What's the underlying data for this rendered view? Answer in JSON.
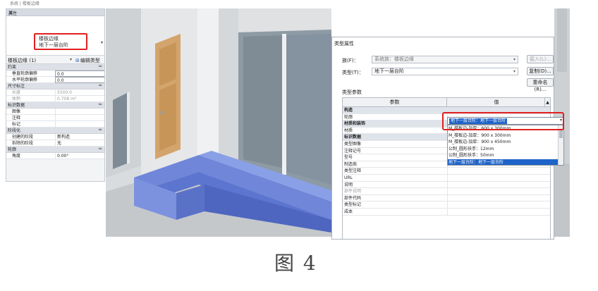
{
  "top_title": "系统 | 楼板边缘",
  "properties_panel": {
    "title": "属性",
    "close_glyph": "×",
    "type_preview": {
      "family": "楼板边缘",
      "type": "地下一层台阶"
    },
    "dropdown_glyph": "▾",
    "selector": {
      "name": "楼板边缘 (1)",
      "edit_type": "编辑类型"
    },
    "rows": [
      {
        "kind": "cat",
        "label": "约束",
        "collapse": "≈"
      },
      {
        "kind": "prop",
        "label": "垂直轮廓偏移",
        "value": "0.0",
        "box": true
      },
      {
        "kind": "prop",
        "label": "水平轮廓偏移",
        "value": "0.0",
        "box": true
      },
      {
        "kind": "cat",
        "label": "尺寸标注",
        "collapse": "≈"
      },
      {
        "kind": "prop",
        "label": "长度",
        "value": "5500.0",
        "gray": true
      },
      {
        "kind": "prop",
        "label": "体积",
        "value": "0.708 m³",
        "gray": true
      },
      {
        "kind": "cat",
        "label": "标识数据",
        "collapse": "≈"
      },
      {
        "kind": "prop",
        "label": "图像",
        "value": ""
      },
      {
        "kind": "prop",
        "label": "注释",
        "value": ""
      },
      {
        "kind": "prop",
        "label": "标记",
        "value": ""
      },
      {
        "kind": "cat",
        "label": "阶段化",
        "collapse": "≈"
      },
      {
        "kind": "prop",
        "label": "创建的阶段",
        "value": "新构造"
      },
      {
        "kind": "prop",
        "label": "拆除的阶段",
        "value": "无"
      },
      {
        "kind": "cat",
        "label": "轮廓",
        "collapse": "≈"
      },
      {
        "kind": "prop",
        "label": "角度",
        "value": "0.00°"
      }
    ]
  },
  "dialog": {
    "title": "类型属性",
    "family_label": "族(F)：",
    "family_value": "系统族：楼板边缘",
    "type_label": "类型(T)：",
    "type_value": "地下一层台阶",
    "buttons": {
      "load": "载入(L)...",
      "duplicate": "复制(D)...",
      "rename": "重命名(R)..."
    },
    "section": "类型参数",
    "columns": {
      "param": "参数",
      "value": "值"
    },
    "rows": [
      {
        "label": "构造",
        "kind": "cat"
      },
      {
        "label": "轮廓",
        "kind": "param"
      },
      {
        "label": "材质和装饰",
        "kind": "cat"
      },
      {
        "label": "材质",
        "kind": "param"
      },
      {
        "label": "标识数据",
        "kind": "cat"
      },
      {
        "label": "类型图像",
        "kind": "param"
      },
      {
        "label": "注释记号",
        "kind": "param"
      },
      {
        "label": "型号",
        "kind": "param"
      },
      {
        "label": "制造商",
        "kind": "param"
      },
      {
        "label": "类型注释",
        "kind": "param"
      },
      {
        "label": "URL",
        "kind": "param"
      },
      {
        "label": "说明",
        "kind": "param"
      },
      {
        "label": "部件说明",
        "kind": "gray"
      },
      {
        "label": "部件代码",
        "kind": "param"
      },
      {
        "label": "类型标记",
        "kind": "param"
      },
      {
        "label": "成本",
        "kind": "param"
      }
    ],
    "profile_value": "地下一层台阶：地下一层台阶",
    "profile_options": [
      "M_楼板边-加厚：600 x 300mm",
      "M_楼板边-加厚：900 x 300mm",
      "M_楼板边-加厚：900 x 450mm",
      "公制_圆形扶手：12mm",
      "公制_圆形扶手：50mm",
      "地下一层台阶：地下一层台阶"
    ],
    "profile_selected_index": 5
  },
  "caption": "图 4",
  "colors": {
    "highlight_red": "#e02020",
    "selection_blue": "#1e63c8",
    "floor_edge_blue": "#6f86d9"
  }
}
